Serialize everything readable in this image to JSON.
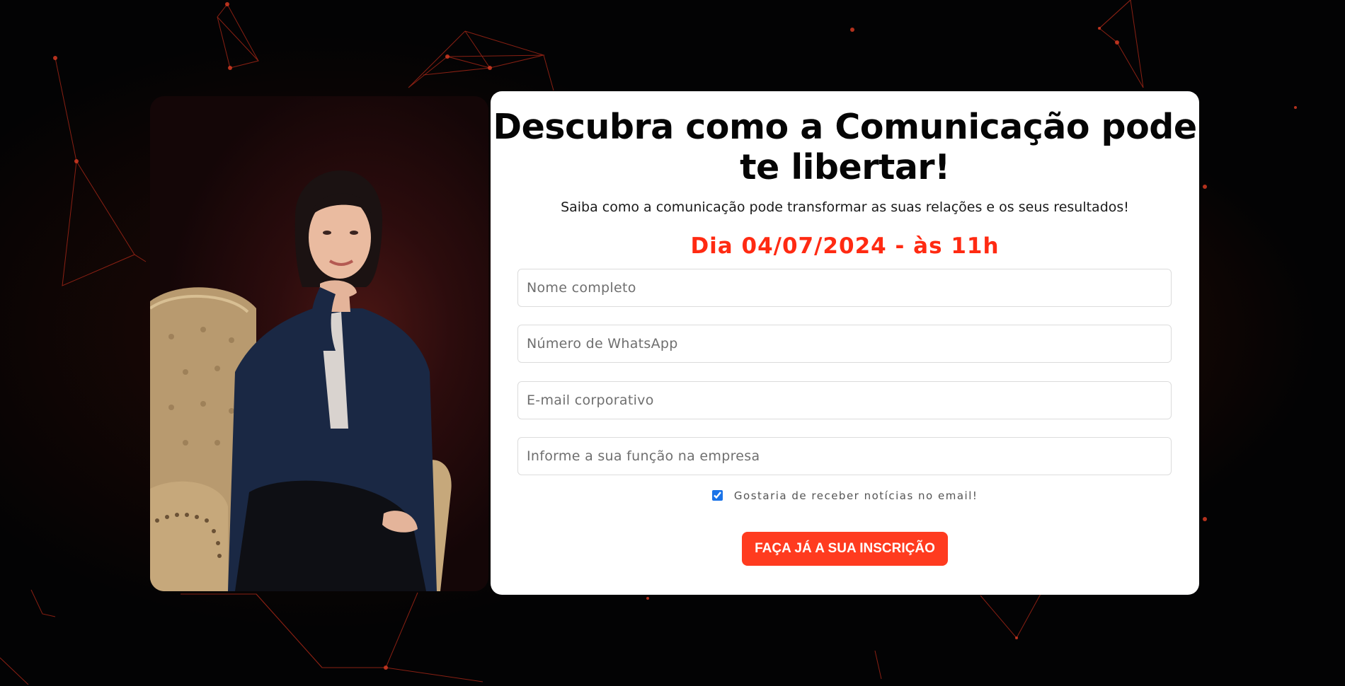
{
  "hero": {
    "title": "Descubra como a Comunicação pode te libertar!",
    "subtitle": "Saiba como a comunicação pode transformar as suas relações e os seus resultados!",
    "event_date": "Dia 04/07/2024 - às 11h"
  },
  "form": {
    "name_placeholder": "Nome completo",
    "whatsapp_placeholder": "Número de WhatsApp",
    "email_placeholder": "E-mail corporativo",
    "role_placeholder": "Informe a sua função na empresa",
    "consent_label": "Gostaria de receber notícias no email!",
    "consent_checked": true,
    "submit_label": "FAÇA JÁ A SUA INSCRIÇÃO"
  },
  "colors": {
    "accent": "#ff3b1f",
    "date_text": "#ff2a12",
    "background": "#030304",
    "network_lines": "#c0301c"
  },
  "icons": {
    "background_decoration": "network-lines-decoration"
  }
}
